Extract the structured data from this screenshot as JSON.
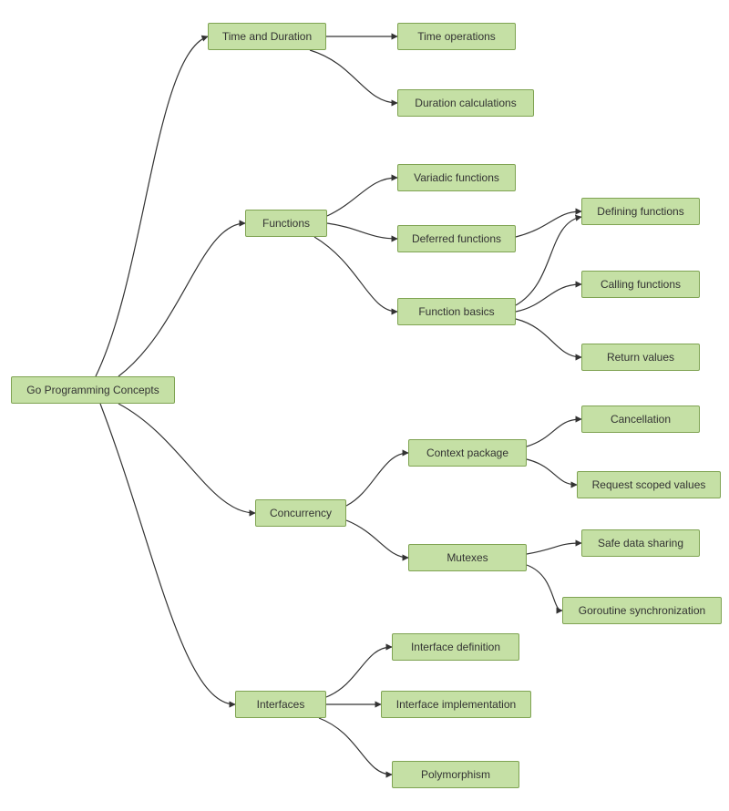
{
  "diagram": {
    "root": "Go Programming Concepts",
    "time_duration": {
      "label": "Time and Duration",
      "children": {
        "time_ops": "Time operations",
        "duration_calc": "Duration calculations"
      }
    },
    "functions": {
      "label": "Functions",
      "children": {
        "variadic": "Variadic functions",
        "deferred": "Deferred functions",
        "basics": {
          "label": "Function basics",
          "children": {
            "defining": "Defining functions",
            "calling": "Calling functions",
            "return": "Return values"
          }
        }
      }
    },
    "concurrency": {
      "label": "Concurrency",
      "children": {
        "context": {
          "label": "Context package",
          "children": {
            "cancellation": "Cancellation",
            "request_scoped": "Request scoped values"
          }
        },
        "mutexes": {
          "label": "Mutexes",
          "children": {
            "safe_sharing": "Safe data sharing",
            "sync": "Goroutine synchronization"
          }
        }
      }
    },
    "interfaces": {
      "label": "Interfaces",
      "children": {
        "definition": "Interface definition",
        "impl": "Interface implementation",
        "poly": "Polymorphism"
      }
    }
  },
  "colors": {
    "node_fill": "#c5e0a5",
    "node_border": "#7fa352",
    "edge": "#333333"
  }
}
